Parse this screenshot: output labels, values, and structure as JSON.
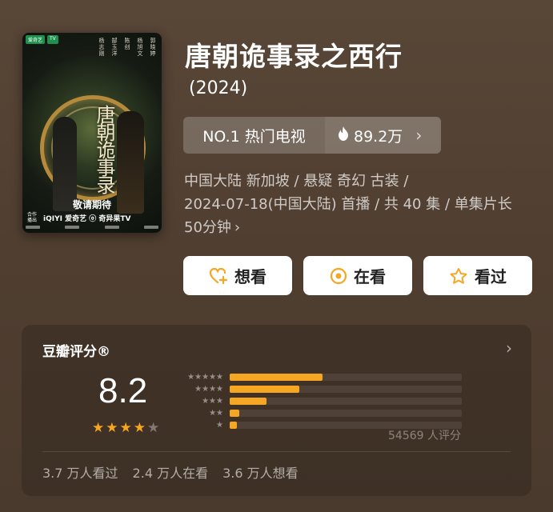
{
  "show": {
    "title": "唐朝诡事录之西行",
    "year": "(2024)",
    "rank_label": "NO.1 热门电视",
    "heat_value": "89.2万",
    "meta_line1": "中国大陆 新加坡 / 悬疑 奇幻 古装 /",
    "meta_line2": "2024-07-18(中国大陆) 首播 / 共 40 集 / 单集片长",
    "meta_line3": "50分钟"
  },
  "poster": {
    "title_art": "唐朝诡事录",
    "subtitle_art": "之西行",
    "coming_text": "敬请期待",
    "platform_tag": "合作播出",
    "platforms": "iQIYI 爱奇艺  ⓞ 奇异果TV"
  },
  "actions": {
    "want_label": "想看",
    "watching_label": "在看",
    "watched_label": "看过"
  },
  "rating": {
    "header": "豆瓣评分®",
    "score": "8.2",
    "stars_filled": 4,
    "stars_total": 5,
    "rating_count": "54569 人评分",
    "distribution": [
      {
        "stars": "★★★★★",
        "percent": 40
      },
      {
        "stars": "★★★★",
        "percent": 30
      },
      {
        "stars": "★★★",
        "percent": 16
      },
      {
        "stars": "★★",
        "percent": 4
      },
      {
        "stars": "★",
        "percent": 3
      }
    ],
    "watched": "3.7 万人看过",
    "watching": "2.4 万人在看",
    "want": "3.6 万人想看"
  },
  "colors": {
    "accent": "#f5a623",
    "background": "#584637"
  }
}
